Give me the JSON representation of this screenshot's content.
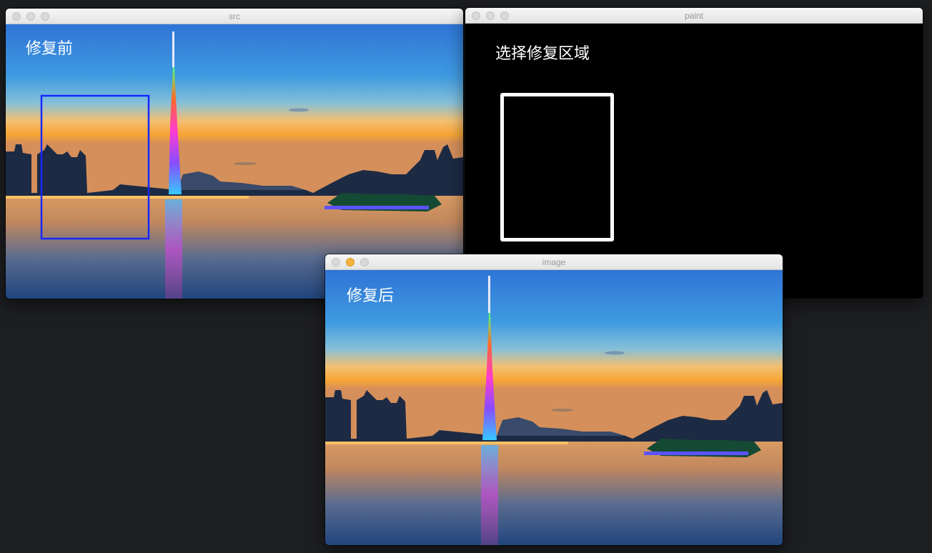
{
  "windows": {
    "src": {
      "title": "src",
      "label": "修复前",
      "selection_color": "#1428ff"
    },
    "paint": {
      "title": "paint",
      "label": "选择修复区域",
      "mask_color": "#ffffff"
    },
    "image": {
      "title": "image",
      "label": "修复后"
    }
  },
  "icons": [
    "close-icon",
    "minimize-icon",
    "zoom-icon"
  ],
  "colors": {
    "desktop": "#1d1e20",
    "titlebar": "#ececec",
    "sky_top": "#2d7fd8",
    "sunset": "#f7a230",
    "water": "#2c4f86"
  }
}
